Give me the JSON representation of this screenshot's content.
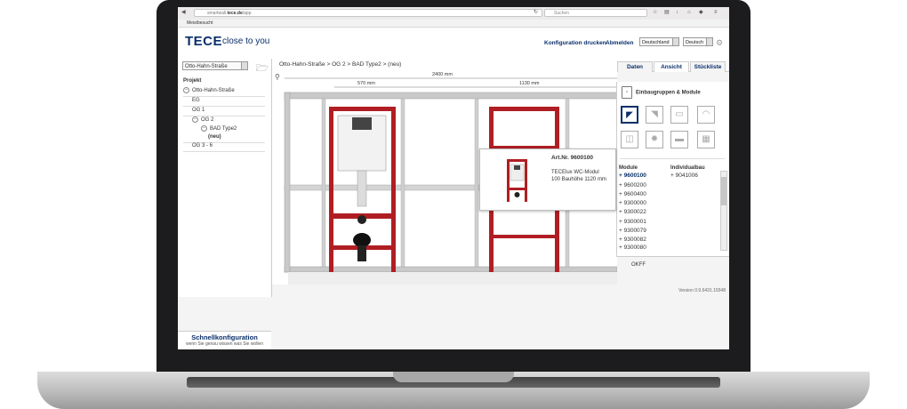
{
  "browser": {
    "url_prefix": "smartwall.",
    "url_domain": "tece.de",
    "url_path": "/app",
    "search_placeholder": "Suchen",
    "bookmark": "Meistbesucht"
  },
  "header": {
    "logo": "TECE",
    "tagline": "close to you",
    "print_config": "Konfiguration drucken",
    "logout": "Abmelden",
    "country": "Deutschland",
    "language": "Deutsch"
  },
  "sidebar": {
    "street_select": "Otto-Hahn-Straße",
    "project_heading": "Projekt",
    "tree": [
      "Otto-Hahn-Straße",
      "EG",
      "OG 1",
      "OG 2",
      "BAD Type2",
      "(neu)",
      "OG 3 - 6"
    ],
    "quick_title": "Schnellkonfiguration",
    "quick_sub": "wenn Sie genau wissen was Sie wollen"
  },
  "main": {
    "breadcrumb": "Otto-Hahn-Straße  >  OG 2  >  BAD Type2  >  (neu)",
    "tabs": [
      "Daten",
      "Ansicht",
      "Stückliste"
    ],
    "dim_total": "2400 mm",
    "dim_left": "570 mm",
    "dim_right": "1130 mm",
    "version": "Version 0.9.6431.19348"
  },
  "panel": {
    "heading": "Einbaugruppen & Module",
    "col_modules": "Module",
    "col_individual": "Individualbau",
    "modules": [
      "+ 9600100",
      "+ 9600200",
      "+ 9600400",
      "+ 9300000",
      "+ 9300022",
      "+ 9300001",
      "+ 9300079",
      "+ 9300082",
      "+ 9300080"
    ],
    "individual": [
      "+ 9041006"
    ]
  },
  "popup": {
    "art_nr": "Art.Nr. 9600100",
    "line1": "TECElux WC-Modul",
    "line2": "100 Bauhöhe 1120 mm"
  },
  "drag_label": "OKFF",
  "colors": {
    "brand": "#0a2f6a",
    "frame_red": "#b01e23"
  }
}
